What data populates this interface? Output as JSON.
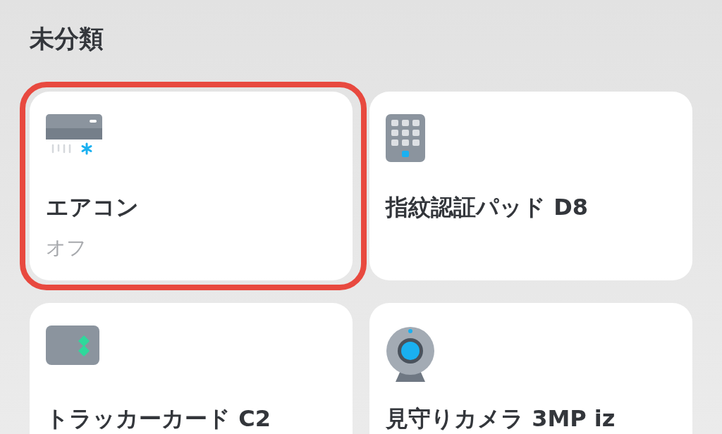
{
  "section": {
    "title": "未分類"
  },
  "cards": [
    {
      "kind": "aircon",
      "name": "エアコン",
      "status": "オフ",
      "highlighted": true
    },
    {
      "kind": "keypad",
      "name": "指紋認証パッド D8",
      "highlighted": false
    },
    {
      "kind": "card",
      "name": "トラッカーカード C2",
      "highlighted": false
    },
    {
      "kind": "camera",
      "name": "見守りカメラ 3MP iz",
      "highlighted": false
    }
  ]
}
